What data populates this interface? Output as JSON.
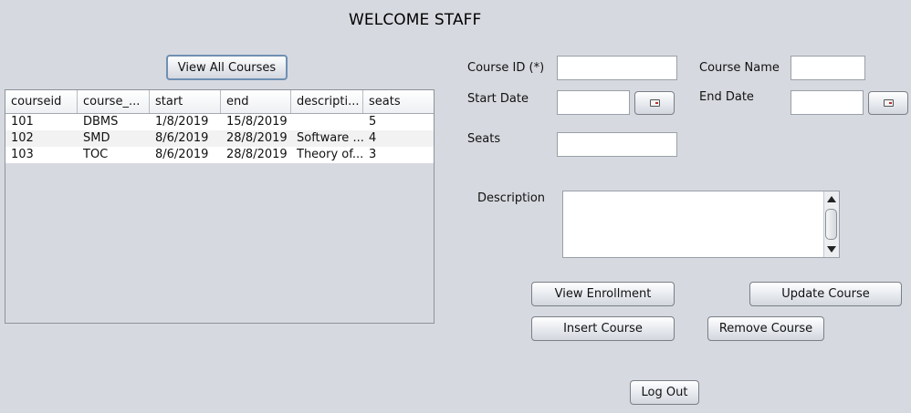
{
  "header": {
    "title": "WELCOME STAFF"
  },
  "left_panel": {
    "view_all_label": "View All Courses",
    "table": {
      "columns": [
        "courseid",
        "course_...",
        "start",
        "end",
        "descripti...",
        "seats"
      ],
      "rows": [
        [
          "101",
          "DBMS",
          "1/8/2019",
          "15/8/2019",
          "",
          "5"
        ],
        [
          "102",
          "SMD",
          "8/6/2019",
          "28/8/2019",
          "Software ...",
          "4"
        ],
        [
          "103",
          "TOC",
          "8/6/2019",
          "28/8/2019",
          "Theory of...",
          "3"
        ]
      ]
    }
  },
  "form": {
    "course_id_label": "Course ID (*)",
    "course_id_value": "",
    "course_name_label": "Course Name",
    "course_name_value": "",
    "start_date_label": "Start Date",
    "start_date_value": "",
    "end_date_label": "End Date",
    "end_date_value": "",
    "seats_label": "Seats",
    "seats_value": "",
    "description_label": "Description",
    "description_value": ""
  },
  "actions": {
    "view_enrollment": "View Enrollment",
    "update_course": "Update Course",
    "insert_course": "Insert Course",
    "remove_course": "Remove Course",
    "log_out": "Log Out"
  }
}
